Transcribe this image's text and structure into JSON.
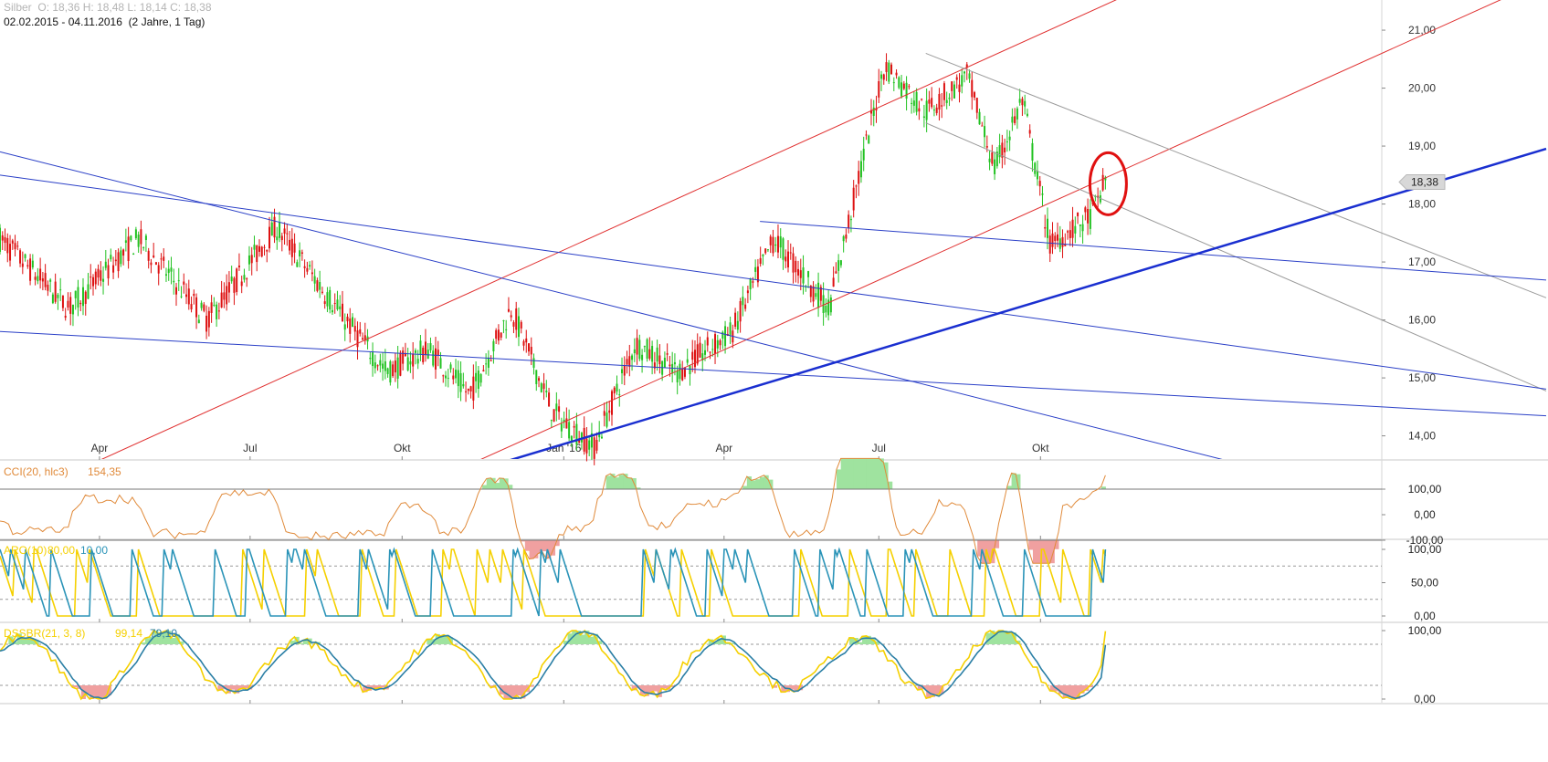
{
  "header": {
    "symbol": "Silber",
    "ohlc": "O: 18,36  H: 18,48  L: 18,14  C: 18,38",
    "range": "02.02.2015 - 04.11.2016",
    "period": "(2 Jahre, 1 Tag)"
  },
  "chart_data": {
    "type": "candlestick",
    "instrument": "Silber",
    "date_range": [
      "2015-02-02",
      "2016-11-04"
    ],
    "last_price": 18.38,
    "last_price_label": "18,38",
    "x_tick_labels": [
      "Apr",
      "Jul",
      "Okt",
      "Jan '16",
      "Apr",
      "Jul",
      "Okt"
    ],
    "y_axis": {
      "ticks": [
        14,
        15,
        16,
        17,
        18,
        19,
        20,
        21
      ],
      "tick_labels": [
        "14,00",
        "15,00",
        "16,00",
        "17,00",
        "18,00",
        "19,00",
        "20,00",
        "21,00"
      ],
      "ylim": [
        13.6,
        21.3
      ]
    },
    "price_path": [
      {
        "x": 0,
        "y": 17.4
      },
      {
        "x": 0.05,
        "y": 16.2
      },
      {
        "x": 0.1,
        "y": 17.4
      },
      {
        "x": 0.15,
        "y": 16.0
      },
      {
        "x": 0.2,
        "y": 17.6
      },
      {
        "x": 0.25,
        "y": 16.0
      },
      {
        "x": 0.28,
        "y": 15.1
      },
      {
        "x": 0.31,
        "y": 15.5
      },
      {
        "x": 0.34,
        "y": 14.7
      },
      {
        "x": 0.37,
        "y": 16.2
      },
      {
        "x": 0.4,
        "y": 14.4
      },
      {
        "x": 0.43,
        "y": 13.8
      },
      {
        "x": 0.46,
        "y": 15.6
      },
      {
        "x": 0.49,
        "y": 15.1
      },
      {
        "x": 0.53,
        "y": 15.8
      },
      {
        "x": 0.56,
        "y": 17.4
      },
      {
        "x": 0.6,
        "y": 16.2
      },
      {
        "x": 0.64,
        "y": 20.4
      },
      {
        "x": 0.67,
        "y": 19.6
      },
      {
        "x": 0.7,
        "y": 20.2
      },
      {
        "x": 0.72,
        "y": 18.6
      },
      {
        "x": 0.74,
        "y": 19.8
      },
      {
        "x": 0.76,
        "y": 17.3
      },
      {
        "x": 0.79,
        "y": 17.8
      },
      {
        "x": 0.8,
        "y": 18.4
      }
    ],
    "trendlines": [
      {
        "color": "red",
        "from": [
          0.0,
          12.8
        ],
        "to": [
          1.0,
          23.6
        ]
      },
      {
        "color": "red",
        "from": [
          0.33,
          13.4
        ],
        "to": [
          1.0,
          20.6
        ]
      },
      {
        "color": "gray",
        "from": [
          0.67,
          20.6
        ],
        "to": [
          1.0,
          17.5
        ]
      },
      {
        "color": "gray",
        "from": [
          0.67,
          19.4
        ],
        "to": [
          1.0,
          16.0
        ]
      },
      {
        "color": "blue",
        "from": [
          0.0,
          18.9
        ],
        "to": [
          1.0,
          12.9
        ]
      },
      {
        "color": "blue",
        "from": [
          0.0,
          18.5
        ],
        "to": [
          1.0,
          15.2
        ]
      },
      {
        "color": "blue",
        "from": [
          0.0,
          15.8
        ],
        "to": [
          1.0,
          14.5
        ]
      },
      {
        "color": "blue",
        "from": [
          0.55,
          17.7
        ],
        "to": [
          1.0,
          16.9
        ]
      },
      {
        "color": "blue-bold",
        "from": [
          0.33,
          13.3
        ],
        "to": [
          1.0,
          18.1
        ]
      }
    ],
    "annotation": "circle-around-last-candles",
    "indicators": [
      {
        "name": "CCI(20, hlc3)",
        "value": "154,35",
        "levels": [
          100,
          0,
          -100
        ],
        "level_labels": [
          "100,00",
          "0,00",
          "-100,00"
        ]
      },
      {
        "name": "ARO(10)",
        "values": [
          "80,00",
          "10,00"
        ],
        "tick_labels": [
          "100,00",
          "50,00",
          "0,00"
        ]
      },
      {
        "name": "DSSBR(21, 3, 8)",
        "values": [
          "99,14",
          "79,10"
        ],
        "tick_labels": [
          "100,00",
          "0,00"
        ]
      }
    ]
  },
  "colors": {
    "up": "#22c222",
    "down": "#dd1111",
    "trend_red": "#e03030",
    "trend_blue": "#2a3fc7",
    "trend_gray": "#9a9a9a",
    "cci_line": "#e08a3a",
    "aroon_up": "#f5d000",
    "aroon_down": "#2b94b8",
    "dss_fast": "#f5d000",
    "dss_slow": "#2b7fa5",
    "fill_green": "#9fe39f",
    "fill_red": "#f0a0a0",
    "circle": "#e01010"
  }
}
